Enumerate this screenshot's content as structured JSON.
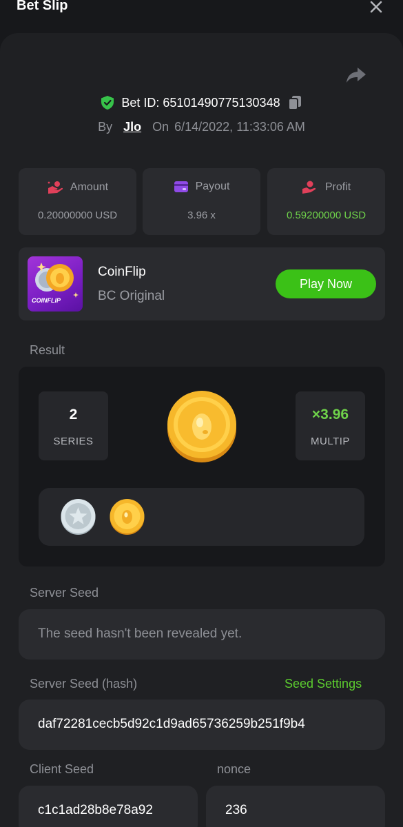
{
  "header": {
    "title": "Bet Slip"
  },
  "bet": {
    "id_text": "Bet ID: 65101490775130348",
    "by_label": "By",
    "username": "Jlo",
    "on_label": "On",
    "datetime": "6/14/2022, 11:33:06 AM"
  },
  "stats": {
    "amount": {
      "label": "Amount",
      "value": "0.20000000 USD"
    },
    "payout": {
      "label": "Payout",
      "value": "3.96 x"
    },
    "profit": {
      "label": "Profit",
      "value": "0.59200000 USD"
    }
  },
  "game": {
    "name": "CoinFlip",
    "subtitle": "BC Original",
    "thumb_label": "COINFLIP",
    "play_label": "Play Now"
  },
  "result": {
    "label": "Result",
    "series_value": "2",
    "series_label": "SERIES",
    "multiplier_value": "×3.96",
    "multiplier_label": "MULTIP",
    "history": [
      "silver-star-coin",
      "gold-egg-coin"
    ]
  },
  "seeds": {
    "server_seed_label": "Server Seed",
    "server_seed_placeholder": "The seed hasn't been revealed yet.",
    "server_hash_label": "Server Seed (hash)",
    "seed_settings_label": "Seed Settings",
    "server_hash_value": "daf72281cecb5d92c1d9ad65736259b251f9b4",
    "client_seed_label": "Client Seed",
    "client_seed_value": "c1c1ad28b8e78a92",
    "nonce_label": "nonce",
    "nonce_value": "236"
  },
  "colors": {
    "background": "#17181b",
    "panel": "#1f2023",
    "card": "#2a2b2f",
    "accent_green": "#3bc117",
    "profit_green": "#6fd34a",
    "muted_text": "#8e9096"
  },
  "icons": [
    "close-icon",
    "share-icon",
    "shield-check-icon",
    "copy-icon",
    "amount-icon",
    "payout-card-icon",
    "profit-icon"
  ]
}
